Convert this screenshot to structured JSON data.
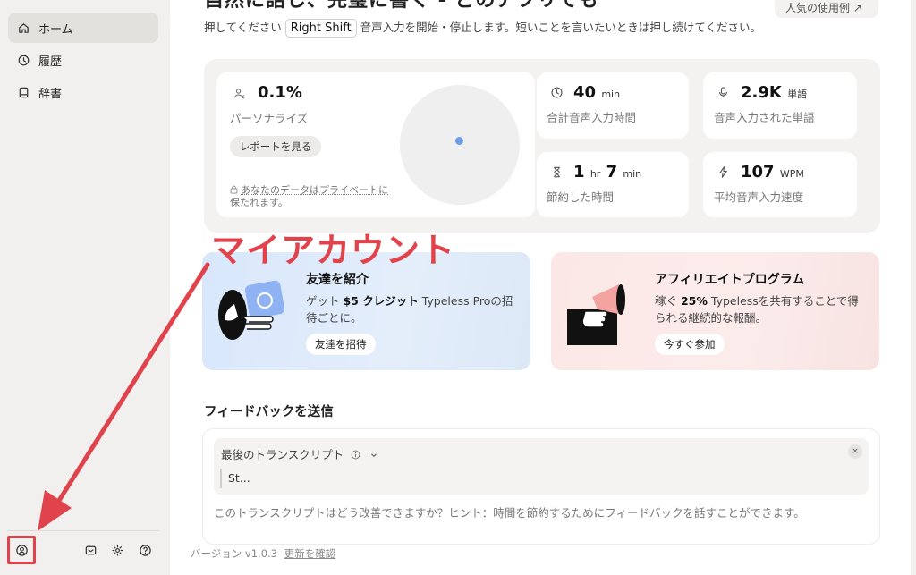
{
  "sidebar": {
    "items": [
      {
        "label": "ホーム",
        "icon": "home-icon",
        "active": true
      },
      {
        "label": "履歴",
        "icon": "history-icon",
        "active": false
      },
      {
        "label": "辞書",
        "icon": "book-icon",
        "active": false
      }
    ],
    "footer_icons": [
      "account-icon",
      "mail-icon",
      "gear-icon",
      "help-icon"
    ]
  },
  "header": {
    "headline": "自然に話し、完璧に書く - どのアプリでも",
    "examples_button": "人気の使用例 ↗",
    "instruction_before": "押してください",
    "hotkey": "Right Shift",
    "instruction_after": "音声入力を開始・停止します。短いことを言いたいときは押し続けてください。"
  },
  "stats": {
    "personalization": {
      "value": "0.1%",
      "label": "パーソナライズ",
      "button": "レポートを見る",
      "privacy_line1": "あなたのデータはプライベートに",
      "privacy_line2": "保たれます。",
      "progress_fraction": 0.001
    },
    "total_time": {
      "number": "40",
      "unit": "min",
      "label": "合計音声入力時間"
    },
    "words": {
      "number": "2.9K",
      "unit": "単語",
      "label": "音声入力された単語"
    },
    "saved_time": {
      "hours": "1",
      "hr_unit": "hr",
      "minutes": "7",
      "min_unit": "min",
      "label": "節約した時間"
    },
    "speed": {
      "number": "107",
      "unit": "WPM",
      "label": "平均音声入力速度"
    }
  },
  "annotation": {
    "text": "マイアカウント",
    "color": "#e0434b"
  },
  "promos": {
    "referral": {
      "title": "友達を紹介",
      "desc_prefix": "ゲット ",
      "desc_bold": "$5 クレジット",
      "desc_suffix": " Typeless Proの招待ごとに。",
      "button": "友達を招待"
    },
    "affiliate": {
      "title": "アフィリエイトプログラム",
      "desc_prefix": "稼ぐ ",
      "desc_bold": "25%",
      "desc_suffix": " Typelessを共有することで得られる継続的な報酬。",
      "button": "今すぐ参加"
    }
  },
  "feedback": {
    "title": "フィードバックを送信",
    "transcript_label": "最後のトランスクリプト",
    "transcript_text": "St...",
    "close": "×",
    "hint": "このトランスクリプトはどう改善できますか？ヒント：時間を節約するためにフィードバックを話すことができます。"
  },
  "version": {
    "label": "バージョン v1.0.3",
    "check_link": "更新を確認"
  },
  "colors": {
    "accent_red": "#e0434b",
    "chart_dot": "#6b9de9"
  }
}
